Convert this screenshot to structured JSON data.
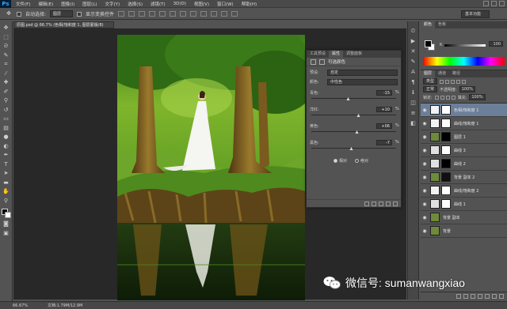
{
  "app": {
    "logo": "Ps"
  },
  "menu": {
    "items": [
      "文件(F)",
      "编辑(E)",
      "图像(I)",
      "图层(L)",
      "文字(Y)",
      "选择(S)",
      "滤镜(T)",
      "3D(D)",
      "视图(V)",
      "窗口(W)",
      "帮助(H)"
    ]
  },
  "options": {
    "auto_select_label": "自动选择:",
    "auto_select_value": "图层",
    "transform_label": "显示变换控件",
    "workspace": "基本功能"
  },
  "document": {
    "tab_title": "原图.psd @ 66.7% (色相/饱和度 1, 图层蒙版/8)",
    "zoom": "66.67%",
    "doc_info": "文档:1.79M/12.9M"
  },
  "properties_panel": {
    "tabs": [
      "工具预设",
      "属性",
      "调整面板"
    ],
    "title": "可选颜色",
    "preset_label": "预设:",
    "preset_value": "自定",
    "colors_label": "颜色:",
    "colors_value": "中性色",
    "sliders": [
      {
        "label": "青色:",
        "value": "-15",
        "fraction": 0.43
      },
      {
        "label": "洋红:",
        "value": "+10",
        "fraction": 0.55
      },
      {
        "label": "黄色:",
        "value": "+06",
        "fraction": 0.53
      },
      {
        "label": "黑色:",
        "value": "-7",
        "fraction": 0.47
      }
    ],
    "mode_relative": "相对",
    "mode_absolute": "绝对",
    "percent": "%"
  },
  "color_panel": {
    "tabs": [
      "颜色",
      "色板"
    ],
    "k_label": "K",
    "k_value": "100"
  },
  "layers_panel": {
    "tabs": [
      "图层",
      "通道",
      "路径"
    ],
    "kind_filter": "类型",
    "blend_mode": "正常",
    "opacity_label": "不透明度:",
    "opacity_value": "100%",
    "lock_label": "锁定:",
    "fill_label": "填充:",
    "fill_value": "100%",
    "layers": [
      {
        "name": "色相/饱和度 1",
        "thumb": "#f2f2f2",
        "mask": "#ffffff",
        "selected": true
      },
      {
        "name": "曲线/饱和度 1",
        "thumb": "#f2f2f2",
        "mask": "#ffffff",
        "selected": false
      },
      {
        "name": "图层 1",
        "thumb": "#6f8a3a",
        "mask": "#000000",
        "selected": false
      },
      {
        "name": "曲线 3",
        "thumb": "#e0e0e0",
        "mask": "#ffffff",
        "selected": false
      },
      {
        "name": "曲线 2",
        "thumb": "#e0e0e0",
        "mask": "#000000",
        "selected": false
      },
      {
        "name": "背景 副本 2",
        "thumb": "#6f8a3a",
        "mask": "#101010",
        "selected": false
      },
      {
        "name": "曲线/饱和度 2",
        "thumb": "#f2f2f2",
        "mask": "#ffffff",
        "selected": false
      },
      {
        "name": "曲线 1",
        "thumb": "#e0e0e0",
        "mask": "#ffffff",
        "selected": false
      },
      {
        "name": "背景 副本",
        "thumb": "#6f8a3a",
        "mask": "",
        "selected": false
      },
      {
        "name": "背景",
        "thumb": "#6f8a3a",
        "mask": "",
        "selected": false
      }
    ]
  },
  "watermark": {
    "text": "微信号: sumanwangxiao"
  }
}
